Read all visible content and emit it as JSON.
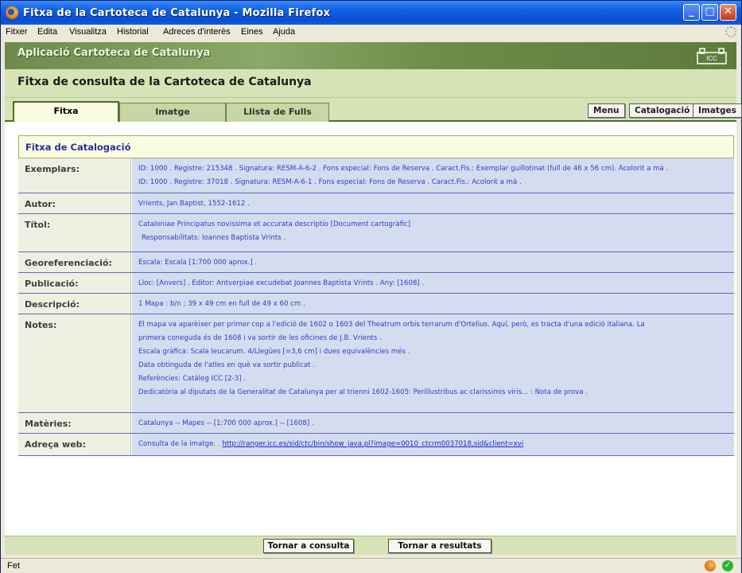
{
  "window": {
    "title": "Fitxa de la Cartoteca de Catalunya - Mozilla Firefox"
  },
  "menu": [
    "Fitxer",
    "Edita",
    "Visualitza",
    "Historial",
    "Adreces d'interès",
    "Eines",
    "Ajuda"
  ],
  "app": {
    "name": "Aplicació Cartoteca de Catalunya",
    "logo": "ICC"
  },
  "page": {
    "title": "Fitxa de consulta de la Cartoteca de Catalunya"
  },
  "tabs": [
    "Fitxa",
    "Imatge",
    "Llista de Fulls"
  ],
  "active_tab": "Fitxa",
  "right_buttons": [
    "Menu",
    "Catalogació",
    "Imatges"
  ],
  "card": {
    "title": "Fitxa de Catalogació",
    "rows": [
      {
        "label": "Exemplars:",
        "lines": [
          "ID: 1000 . Registre: 215348 . Signatura: RESM-A-6-2 . Fons especial: Fons de Reserva . Caract.Fis.: Exemplar guillotinat (full de 46 x 56 cm). Acolorit a mà .",
          "ID: 1000 . Registre: 37018 . Signatura: RESM-A-6-1 . Fons especial: Fons de Reserva . Caract.Fis.: Acolorit a mà ."
        ]
      },
      {
        "label": "Autor:",
        "lines": [
          "Vrients, Jan Baptist, 1552-1612 ."
        ]
      },
      {
        "label": "Títol:",
        "lines": [
          "Cataloniae Principatus novissima et accurata descriptio [Document cartogràfic]",
          "Responsabilitats: Ioannes Baptista Vrints ."
        ]
      },
      {
        "label": "Georeferenciació:",
        "lines": [
          "Escala: Escala [1:700 000 aprox.] ."
        ]
      },
      {
        "label": "Publicació:",
        "lines": [
          "Lloc: [Anvers] . Editor: Antverpiae excudebat Joannes Baptista Vrints . Any: [1608] ."
        ]
      },
      {
        "label": "Descripció:",
        "lines": [
          "1 Mapa : b/n ; 39 x 49 cm en full de 49 x 60 cm ."
        ]
      },
      {
        "label": "Notes:",
        "lines": [
          "El mapa va aparèixer per primer cop a l'edició de 1602 o 1603 del Theatrum orbis terrarum d'Ortelius. Aquí, però, es tracta d'una edició italiana. La",
          "primera coneguda és de 1608 i va sortir de les oficines de J.B. Vrients .",
          "Escala gràfica: Scala leucarum. 4/Llegües [=3,6 cm] i dues equivalències més .",
          "Data obtinguda de l'atles en què va sortir publicat .",
          "Referències: Catàleg ICC [2-3] .",
          "Dedicatòria al diputats de la Generalitat de Catalunya per al trienni 1602-1605: Perillustribus ac clarissimis viris... : Nota de prova ."
        ]
      },
      {
        "label": "Matèries:",
        "lines": [
          "Catalunya -- Mapes -- [1:700 000 aprox.] -- [1608] ."
        ]
      },
      {
        "label": "Adreça web:",
        "lines": [
          "Consulta de la imatge. . "
        ],
        "link": "http://ranger.icc.es/sid/ctc/bin/show_java.pl?image=0010_ctcrm0037018.sid&client=xvi"
      }
    ]
  },
  "bottom_buttons": [
    "Tornar a consulta",
    "Tornar a resultats"
  ],
  "status": {
    "text": "Fet"
  }
}
